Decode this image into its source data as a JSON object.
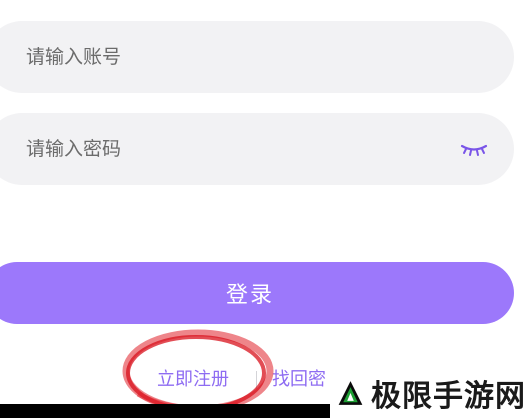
{
  "login": {
    "account_placeholder": "请输入账号",
    "password_placeholder": "请输入密码",
    "submit_label": "登录"
  },
  "footer_links": {
    "register": "立即注册",
    "forgot_password": "找回密"
  },
  "watermark": {
    "text": "极限手游网"
  },
  "icons": {
    "password_toggle": "eye-closed-icon",
    "watermark_logo": "triangle-a-logo-icon"
  },
  "colors": {
    "accent": "#9c78fb",
    "link": "#8e6cf2",
    "field_bg": "#f2f2f4",
    "annotation": "#e0202a"
  }
}
